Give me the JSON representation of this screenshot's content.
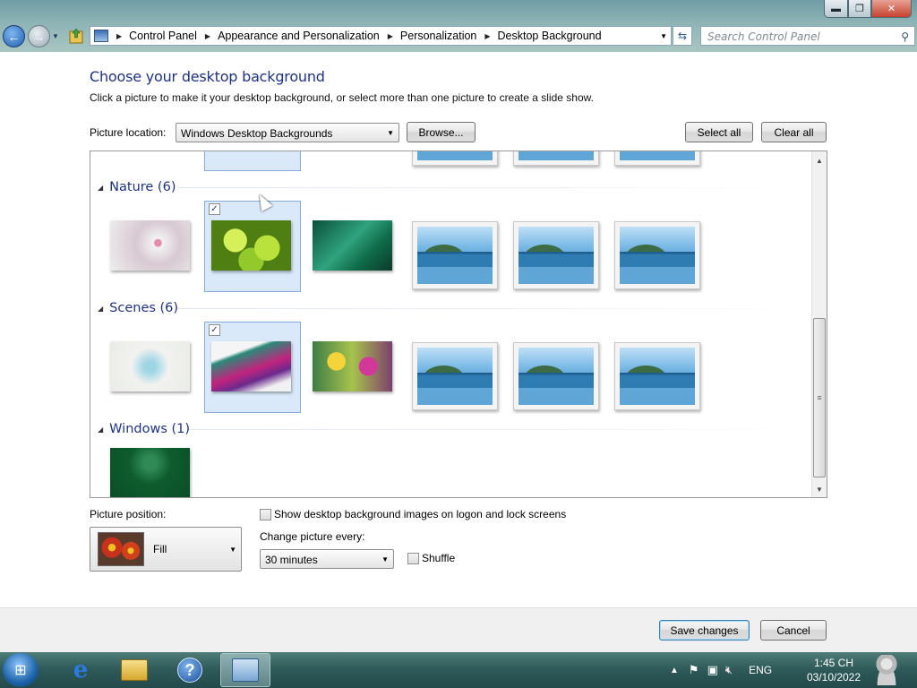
{
  "window": {
    "caption": {
      "minimize": "▬",
      "maximize": "❐",
      "close": "✕"
    }
  },
  "address_bar": {
    "breadcrumb": [
      "Control Panel",
      "Appearance and Personalization",
      "Personalization",
      "Desktop Background"
    ],
    "search_placeholder": "Search Control Panel"
  },
  "main": {
    "title": "Choose your desktop background",
    "subtitle": "Click a picture to make it your desktop background, or select more than one picture to create a slide show.",
    "picture_location_label": "Picture location:",
    "picture_location_value": "Windows Desktop Backgrounds",
    "browse_label": "Browse...",
    "select_all_label": "Select all",
    "clear_all_label": "Clear all"
  },
  "gallery": {
    "groups": [
      {
        "label": "Nature (6)",
        "selected_index": 1
      },
      {
        "label": "Scenes (6)",
        "selected_index": 1
      },
      {
        "label": "Windows (1)",
        "selected_index": -1
      }
    ],
    "check_mark": "✓"
  },
  "options": {
    "picture_position_label": "Picture position:",
    "picture_position_value": "Fill",
    "logon_checkbox_label": "Show desktop background images on logon and lock screens",
    "logon_checked": false,
    "change_every_label": "Change picture every:",
    "change_every_value": "30 minutes",
    "shuffle_label": "Shuffle",
    "shuffle_checked": false
  },
  "footer": {
    "save_label": "Save changes",
    "cancel_label": "Cancel"
  },
  "taskbar": {
    "language": "ENG",
    "time": "1:45 CH",
    "date": "03/10/2022",
    "icons": [
      "start-orb",
      "internet-explorer-icon",
      "windows-explorer-icon",
      "help-icon",
      "control-panel-icon"
    ]
  },
  "colors": {
    "heading": "#1e3287",
    "selection": "#d9e9fa",
    "taskbar": "#2f5b5a"
  }
}
